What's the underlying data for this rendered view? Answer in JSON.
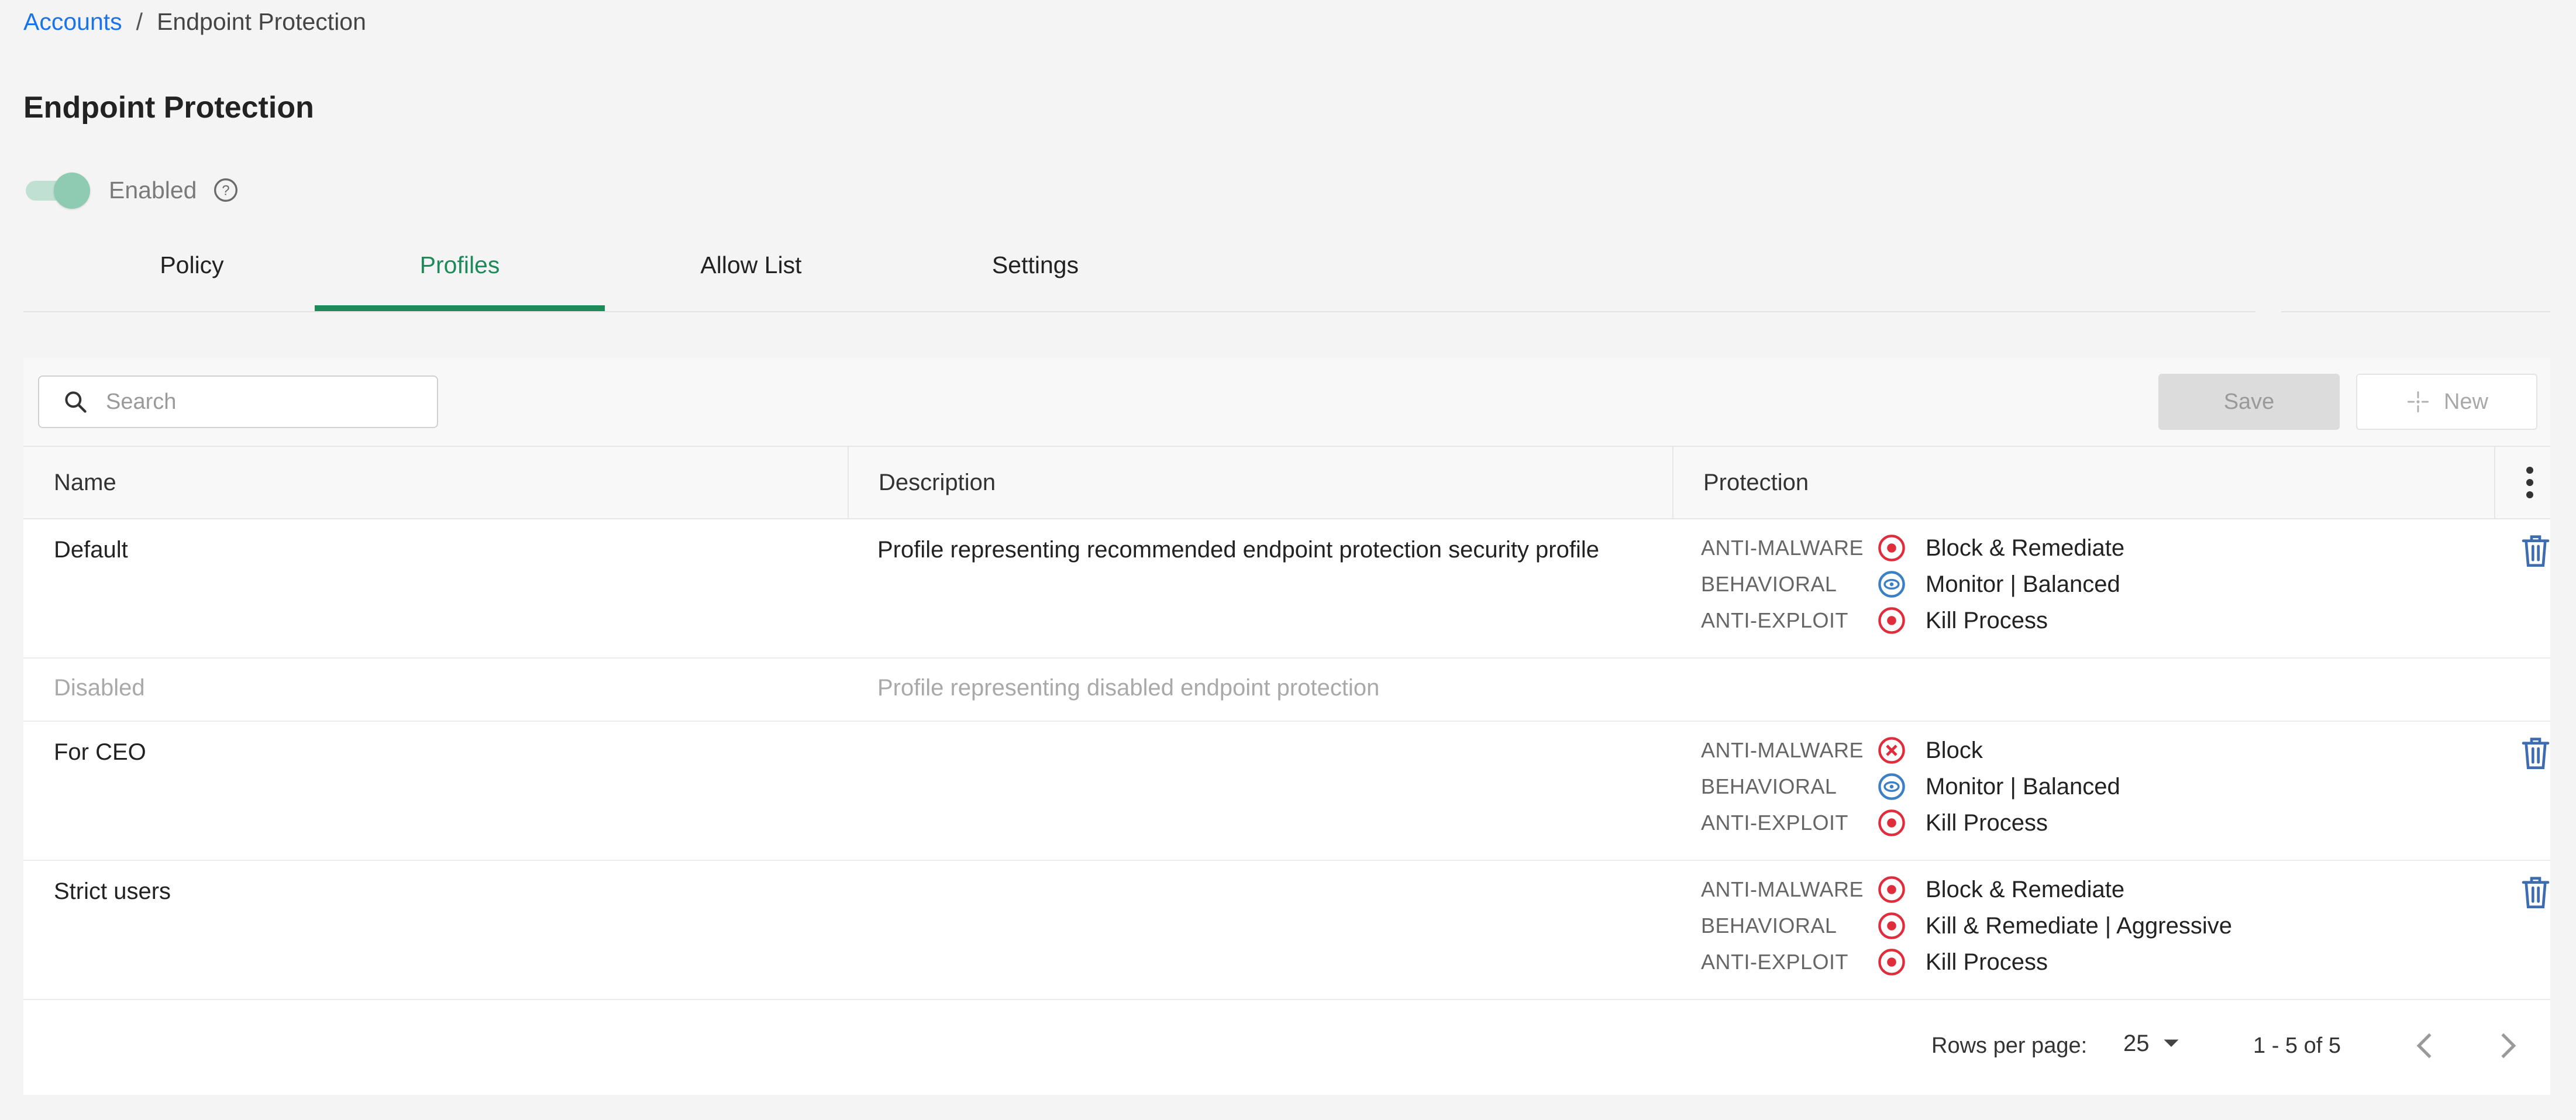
{
  "breadcrumb": {
    "root": "Accounts",
    "separator": "/",
    "current": "Endpoint Protection"
  },
  "page": {
    "title": "Endpoint Protection"
  },
  "status_toggle": {
    "label": "Enabled",
    "on": true
  },
  "tabs": [
    {
      "label": "Policy",
      "active": false
    },
    {
      "label": "Profiles",
      "active": true
    },
    {
      "label": "Allow List",
      "active": false
    },
    {
      "label": "Settings",
      "active": false
    }
  ],
  "toolbar": {
    "search_placeholder": "Search",
    "save_label": "Save",
    "new_label": "New"
  },
  "table": {
    "columns": [
      "Name",
      "Description",
      "Protection"
    ],
    "rows": [
      {
        "name": "Default",
        "description": "Profile representing recommended endpoint protection security profile",
        "disabled": false,
        "protection": [
          {
            "category": "ANTI-MALWARE",
            "icon": "target-red-icon",
            "value": "Block & Remediate"
          },
          {
            "category": "BEHAVIORAL",
            "icon": "eye-blue-icon",
            "value": "Monitor | Balanced"
          },
          {
            "category": "ANTI-EXPLOIT",
            "icon": "target-red-icon",
            "value": "Kill Process"
          }
        ]
      },
      {
        "name": "Disabled",
        "description": "Profile representing disabled endpoint protection",
        "disabled": true,
        "protection": []
      },
      {
        "name": "For CEO",
        "description": "",
        "disabled": false,
        "protection": [
          {
            "category": "ANTI-MALWARE",
            "icon": "x-circle-red-icon",
            "value": "Block"
          },
          {
            "category": "BEHAVIORAL",
            "icon": "eye-blue-icon",
            "value": "Monitor | Balanced"
          },
          {
            "category": "ANTI-EXPLOIT",
            "icon": "target-red-icon",
            "value": "Kill Process"
          }
        ]
      },
      {
        "name": "Strict users",
        "description": "",
        "disabled": false,
        "protection": [
          {
            "category": "ANTI-MALWARE",
            "icon": "target-red-icon",
            "value": "Block & Remediate"
          },
          {
            "category": "BEHAVIORAL",
            "icon": "target-red-icon",
            "value": "Kill & Remediate | Aggressive"
          },
          {
            "category": "ANTI-EXPLOIT",
            "icon": "target-red-icon",
            "value": "Kill Process"
          }
        ]
      }
    ]
  },
  "pagination": {
    "rows_per_page_label": "Rows per page:",
    "rows_per_page": "25",
    "range": "1 - 5 of 5"
  },
  "colors": {
    "accent_green": "#1e8a5a",
    "link_blue": "#1a73e8",
    "danger_red": "#e02d3c",
    "info_blue": "#3b7fc4",
    "trash_blue": "#3d6cb0"
  }
}
